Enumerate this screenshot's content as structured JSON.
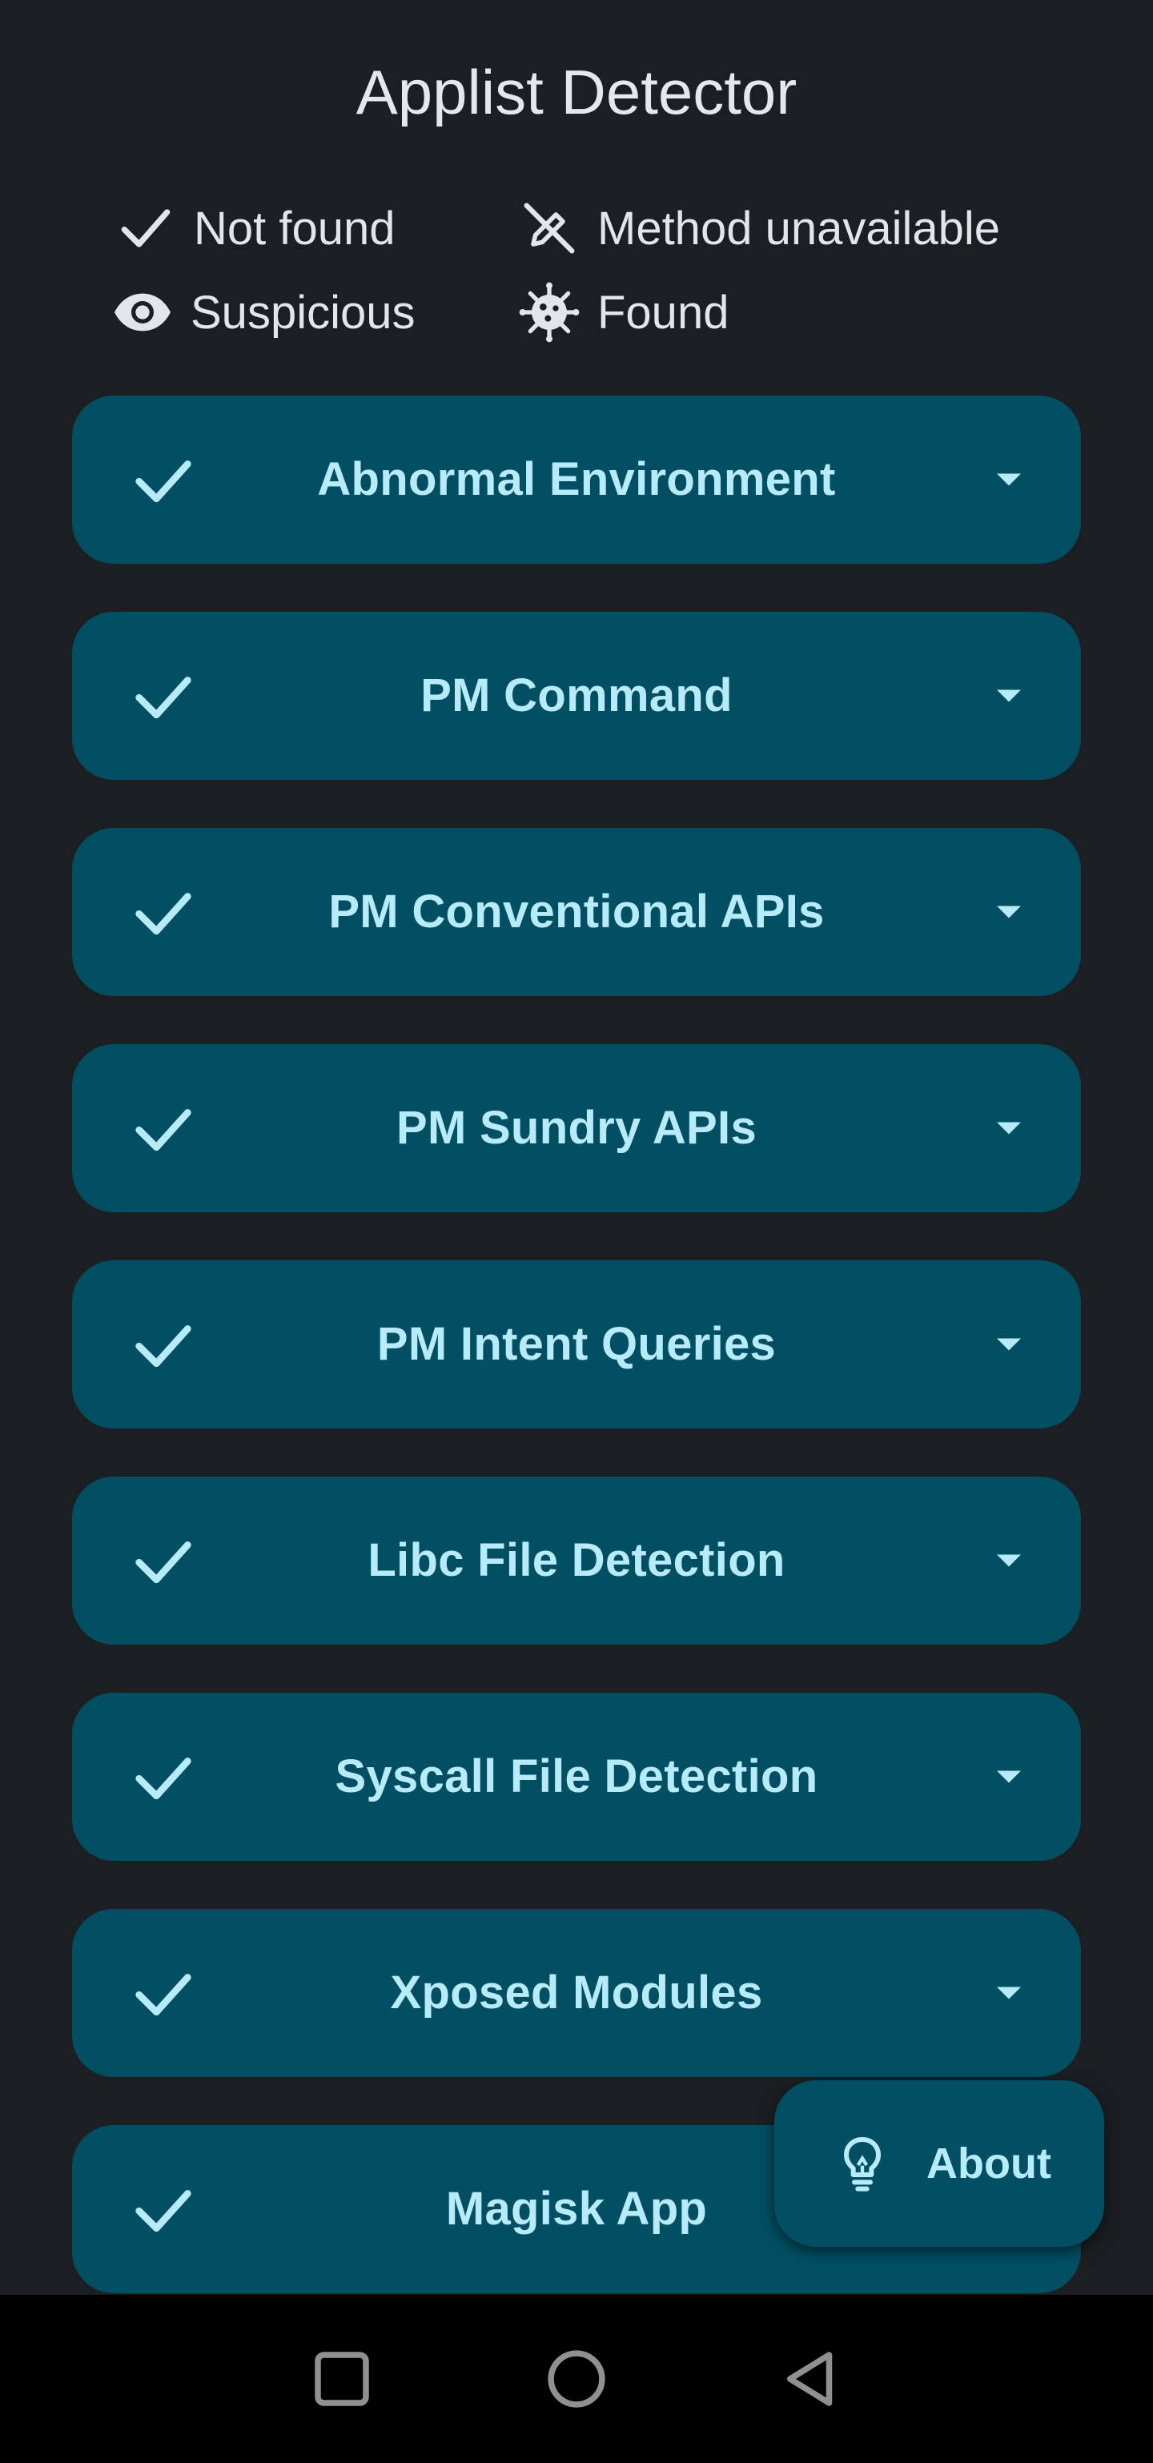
{
  "app": {
    "title": "Applist Detector"
  },
  "legend": {
    "not_found": "Not found",
    "method_unavailable": "Method unavailable",
    "suspicious": "Suspicious",
    "found": "Found"
  },
  "detections": [
    {
      "title": "Abnormal Environment",
      "status": "not_found"
    },
    {
      "title": "PM Command",
      "status": "not_found"
    },
    {
      "title": "PM Conventional APIs",
      "status": "not_found"
    },
    {
      "title": "PM Sundry APIs",
      "status": "not_found"
    },
    {
      "title": "PM Intent Queries",
      "status": "not_found"
    },
    {
      "title": "Libc File Detection",
      "status": "not_found"
    },
    {
      "title": "Syscall File Detection",
      "status": "not_found"
    },
    {
      "title": "Xposed Modules",
      "status": "not_found"
    },
    {
      "title": "Magisk App",
      "status": "not_found"
    }
  ],
  "fab": {
    "label": "About",
    "icon": "lightbulb-icon"
  },
  "colors": {
    "background": "#1b1f21",
    "card": "#024f63",
    "card_text": "#b8ebfa",
    "nav_bar": "#000000"
  }
}
